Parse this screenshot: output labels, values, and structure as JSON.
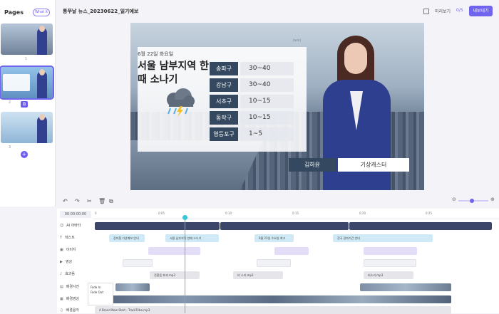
{
  "sidebar": {
    "title": "Pages",
    "add_label": "What it",
    "pages": [
      {
        "number": "1"
      },
      {
        "number": "2"
      },
      {
        "number": "3"
      }
    ]
  },
  "header": {
    "title": "통쭈날 뉴스_20230622_일기예보",
    "preview": "미리보기",
    "page_count": "0/5",
    "export": "내보내기"
  },
  "weather": {
    "date": "6월 22일 화요일",
    "headline": "서울 남부지역 한때 소나기",
    "mark": "[mm]",
    "rows": [
      {
        "district": "송파구",
        "range": "30~40"
      },
      {
        "district": "강남구",
        "range": "30~40"
      },
      {
        "district": "서초구",
        "range": "10~15"
      },
      {
        "district": "동작구",
        "range": "10~15"
      },
      {
        "district": "영등포구",
        "range": "1~5"
      }
    ]
  },
  "anchor": {
    "name": "김하윤",
    "role": "기상캐스터"
  },
  "timeline": {
    "timecode": "00:00:00:00",
    "ticks": [
      "0",
      "0:05",
      "0:10",
      "0:15",
      "0:20",
      "0:25"
    ],
    "tracks": [
      {
        "label": "AI 아바타"
      },
      {
        "label": "텍스트"
      },
      {
        "label": "이미지"
      },
      {
        "label": "영상"
      },
      {
        "label": "효과음"
      },
      {
        "label": "배경사진"
      },
      {
        "label": "배경영상"
      },
      {
        "label": "배경음악"
      }
    ],
    "text_clips": [
      "장마철 기상예보 안내",
      "서울 남부지역 한때 소나기",
      "6월 23일 수요일 최고",
      "전국 장마기간 안내"
    ],
    "sound_clips": [
      "전환음 효과.mp3",
      "비 소리.mp3",
      "비소리.mp3"
    ],
    "music_clip": "A Brand New Start - TrackTribe.mp3",
    "fade_in": "Fade In",
    "fade_out": "Fade Out"
  }
}
